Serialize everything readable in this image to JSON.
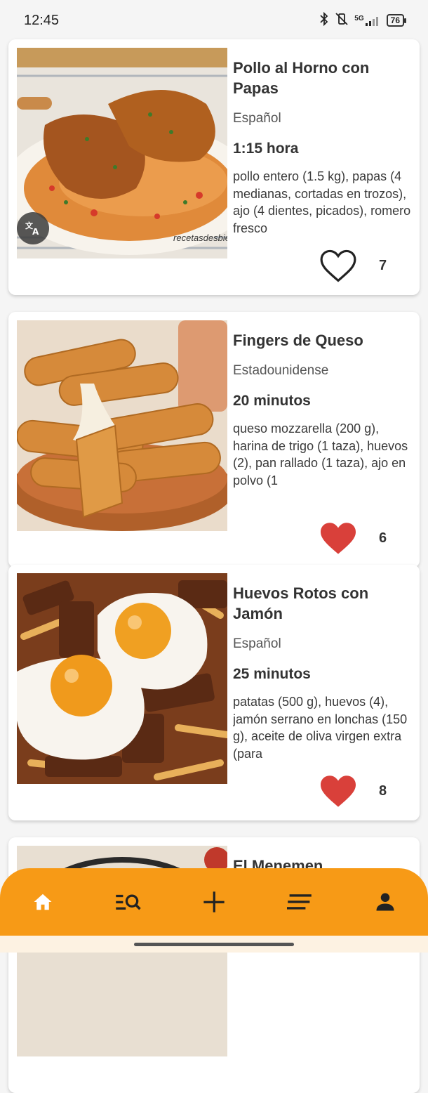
{
  "status_bar": {
    "time": "12:45",
    "network": "5G",
    "battery": "76"
  },
  "recipes": [
    {
      "title": "Pollo al Horno con Papas",
      "cuisine": "Español",
      "time": "1:15 hora",
      "ingredients": "pollo entero (1.5 kg), papas (4 medianas, cortadas en trozos), ajo (4 dientes, picados), romero fresco",
      "likes": "7",
      "liked": false,
      "watermark": "recetasdesbie",
      "image_icon": "roast-chicken-photo"
    },
    {
      "title": "Fingers de Queso",
      "cuisine": "Estadounidense",
      "time": "20 minutos",
      "ingredients": "queso mozzarella (200 g), harina de trigo (1 taza), huevos (2), pan rallado (1 taza), ajo en polvo (1",
      "likes": "6",
      "liked": true,
      "image_icon": "cheese-sticks-photo"
    },
    {
      "title": "Huevos Rotos con Jamón",
      "cuisine": "Español",
      "time": "25 minutos",
      "ingredients": "patatas (500 g), huevos (4), jamón serrano en lonchas (150 g), aceite de oliva virgen extra (para",
      "likes": "8",
      "liked": true,
      "image_icon": "fried-eggs-potatoes-photo"
    },
    {
      "title": "El Menemen",
      "image_icon": "menemen-photo"
    }
  ],
  "nav": [
    {
      "name": "home",
      "icon": "home-icon"
    },
    {
      "name": "search",
      "icon": "search-list-icon"
    },
    {
      "name": "add",
      "icon": "plus-icon"
    },
    {
      "name": "list",
      "icon": "menu-lines-icon"
    },
    {
      "name": "profile",
      "icon": "person-icon"
    }
  ],
  "colors": {
    "accent": "#f79a16",
    "like_active": "#d9403a",
    "like_inactive": "#222222"
  }
}
